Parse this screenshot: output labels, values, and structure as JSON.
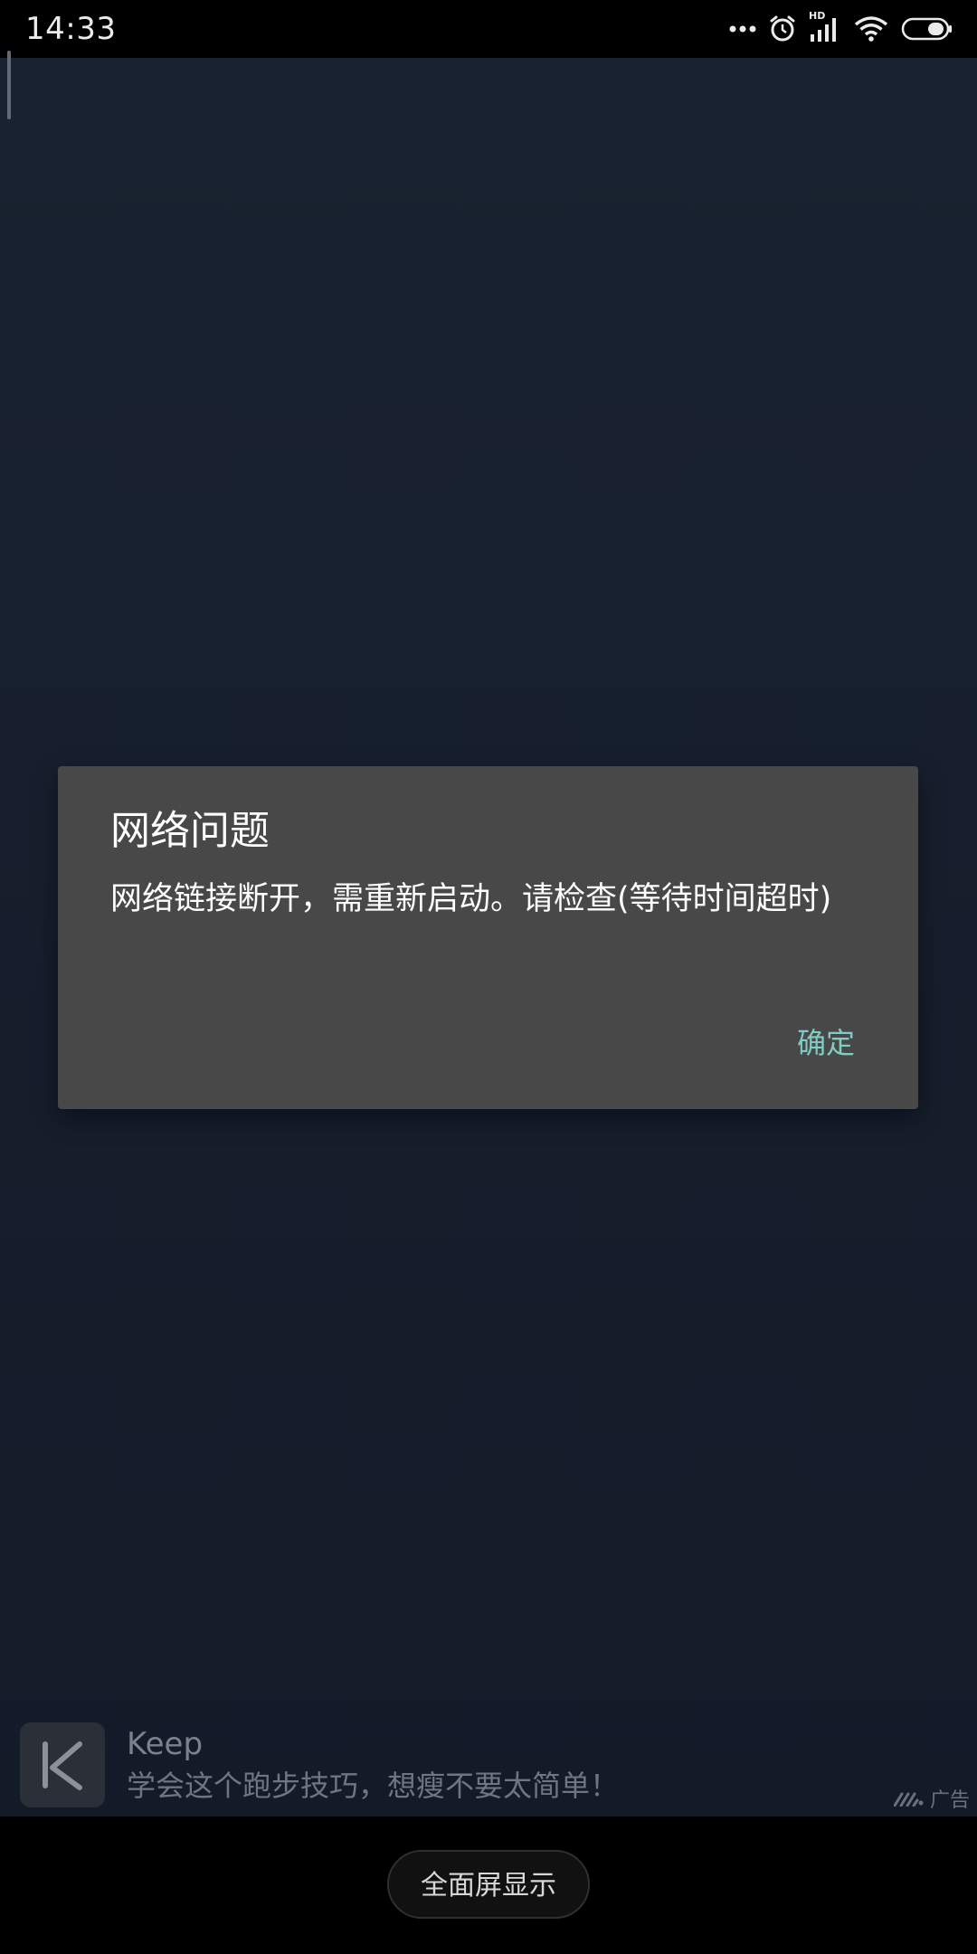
{
  "status_bar": {
    "time": "14:33",
    "icons": [
      "more-dots-icon",
      "alarm-icon",
      "hd-signal-icon",
      "wifi-icon",
      "battery-icon"
    ],
    "hd_label": "HD"
  },
  "dialog": {
    "title": "网络问题",
    "message": "网络链接断开，需重新启动。请检查(等待时间超时)",
    "ok_label": "确定"
  },
  "ad": {
    "logo_icon": "keep-logo-icon",
    "title": "Keep",
    "description": "学会这个跑步技巧，想瘦不要太简单！",
    "tag": "广告"
  },
  "bottom": {
    "fullscreen_label": "全面屏显示"
  },
  "colors": {
    "background": "#172030",
    "dialog": "#484848",
    "accent": "#80cbc4"
  }
}
